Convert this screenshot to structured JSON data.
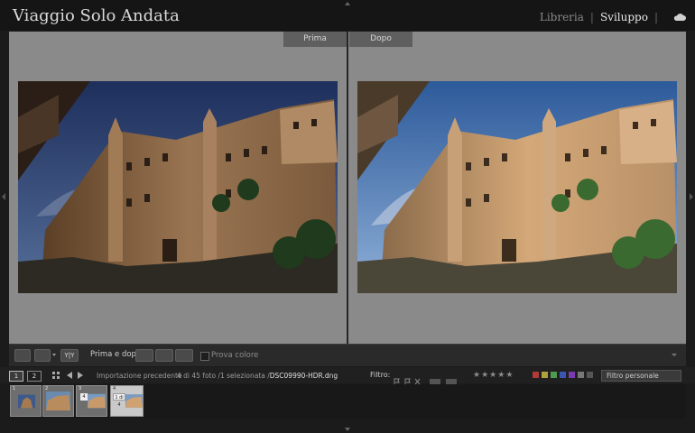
{
  "app": {
    "title": "Viaggio Solo Andata"
  },
  "modules": {
    "library": "Libreria",
    "separator": "|",
    "develop": "Sviluppo"
  },
  "compare": {
    "before_label": "Prima",
    "after_label": "Dopo"
  },
  "toolbar": {
    "view_label": "Prima e dopo:",
    "view_mode_badge": "Y|Y",
    "proof_label": "Prova colore"
  },
  "filmstrip_bar": {
    "monitor_1": "1",
    "monitor_2": "2",
    "source": "Importazione precedente",
    "count_prefix": "4 di 45 foto /1 selezionata /",
    "filename": "DSC09990-HDR.dng",
    "filter_label": "Filtro:",
    "custom_filter": "Filtro personale"
  },
  "filmstrip": {
    "thumbnails": [
      {
        "num": "1",
        "badge": ""
      },
      {
        "num": "2",
        "badge": ""
      },
      {
        "num": "3",
        "badge": "4"
      },
      {
        "num": "4",
        "badge": "1 di 4"
      }
    ]
  },
  "colors": {
    "accent_green": "#4e9a4e",
    "color_red": "#b03a3a",
    "color_yellow": "#b0a13a",
    "color_green": "#4e9a4e",
    "color_blue": "#3a56b0",
    "color_purple": "#7a3ab0",
    "color_gray": "#777777"
  },
  "icons": [
    "cloud-icon",
    "loupe-view-icon",
    "compare-view-icon",
    "swap-icon",
    "grid-icon",
    "back-arrow-icon",
    "forward-arrow-icon",
    "flag-icon",
    "star-icon",
    "chevron-down-icon"
  ]
}
